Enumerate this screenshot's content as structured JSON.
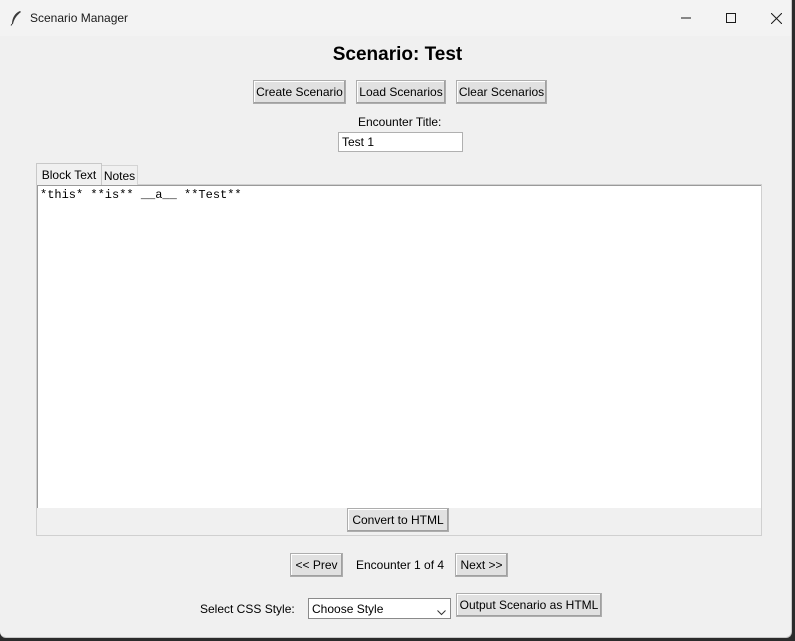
{
  "window": {
    "title": "Scenario Manager",
    "icons": {
      "app": "feather-icon",
      "minimize": "minimize-icon",
      "maximize": "maximize-icon",
      "close": "close-icon"
    }
  },
  "heading": "Scenario: Test",
  "toolbar": {
    "create_label": "Create Scenario",
    "load_label": "Load Scenarios",
    "clear_label": "Clear Scenarios"
  },
  "encounter": {
    "title_label": "Encounter Title:",
    "title_value": "Test 1"
  },
  "tabs": [
    {
      "label": "Block Text",
      "active": true
    },
    {
      "label": "Notes",
      "active": false
    }
  ],
  "editor": {
    "content": "*this* **is** __a__ **Test**"
  },
  "convert_label": "Convert to HTML",
  "navigation": {
    "prev_label": "<< Prev",
    "status": "Encounter 1 of 4",
    "next_label": "Next >>"
  },
  "css_style": {
    "label": "Select CSS Style:",
    "selected": "Choose Style",
    "chevron_icon": "chevron-down-icon"
  },
  "output_label": "Output Scenario as HTML",
  "colors": {
    "window_bg": "#f0f0f0",
    "button_bg": "#e1e1e1",
    "text": "#000000"
  }
}
